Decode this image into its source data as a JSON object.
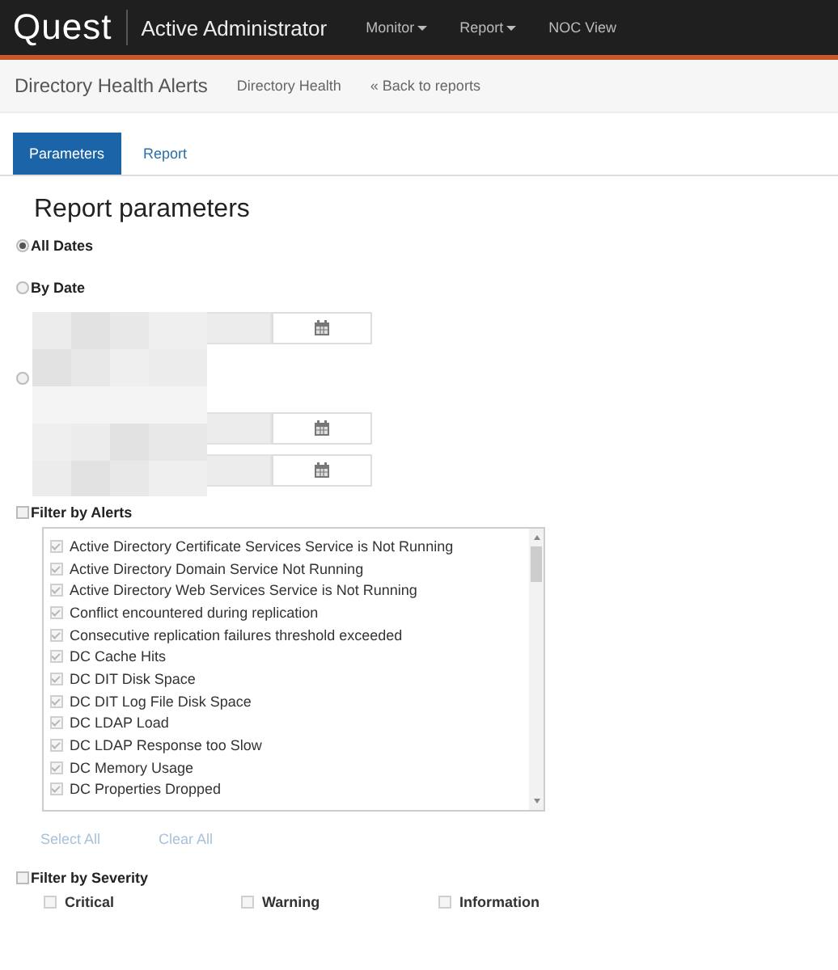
{
  "header": {
    "logo": "Quest",
    "product": "Active Administrator",
    "menu": [
      {
        "label": "Monitor",
        "dropdown": true
      },
      {
        "label": "Report",
        "dropdown": true
      },
      {
        "label": "NOC View",
        "dropdown": false
      }
    ]
  },
  "subnav": {
    "title": "Directory Health Alerts",
    "category": "Directory Health",
    "back_link": "« Back to reports"
  },
  "tabs": [
    {
      "label": "Parameters",
      "selected": true
    },
    {
      "label": "Report",
      "selected": false
    }
  ],
  "heading": "Report parameters",
  "date_options": [
    {
      "label": "All Dates",
      "selected": true
    },
    {
      "label": "By Date",
      "selected": false
    },
    {
      "selected": false
    }
  ],
  "date_fields": [
    {
      "kind": "date"
    },
    {
      "kind": "date"
    },
    {
      "kind": "date"
    }
  ],
  "alerts_filter": {
    "label": "Filter by Alerts",
    "checked": false,
    "items": [
      {
        "label": "Active Directory Certificate Services Service is Not Running",
        "checked": true,
        "disabled": true
      },
      {
        "label": "Active Directory Domain Service Not Running",
        "checked": true,
        "disabled": true
      },
      {
        "label": "Active Directory Web Services Service is Not Running",
        "checked": true,
        "disabled": true
      },
      {
        "label": "Conflict encountered during replication",
        "checked": true,
        "disabled": true
      },
      {
        "label": "Consecutive replication failures threshold exceeded",
        "checked": true,
        "disabled": true
      },
      {
        "label": "DC Cache Hits",
        "checked": true,
        "disabled": true
      },
      {
        "label": "DC DIT Disk Space",
        "checked": true,
        "disabled": true
      },
      {
        "label": "DC DIT Log File Disk Space",
        "checked": true,
        "disabled": true
      },
      {
        "label": "DC LDAP Load",
        "checked": true,
        "disabled": true
      },
      {
        "label": "DC LDAP Response too Slow",
        "checked": true,
        "disabled": true
      },
      {
        "label": "DC Memory Usage",
        "checked": true,
        "disabled": true
      },
      {
        "label": "DC Properties Dropped",
        "checked": true,
        "disabled": true
      }
    ],
    "actions": [
      {
        "label": "Select All",
        "disabled": true
      },
      {
        "label": "Clear All",
        "disabled": true
      }
    ]
  },
  "severity_filter": {
    "label": "Filter by Severity",
    "checked": false,
    "items": [
      {
        "label": "Critical",
        "checked": false,
        "disabled": true
      },
      {
        "label": "Warning",
        "checked": false,
        "disabled": true
      },
      {
        "label": "Information",
        "checked": false,
        "disabled": true
      }
    ]
  }
}
